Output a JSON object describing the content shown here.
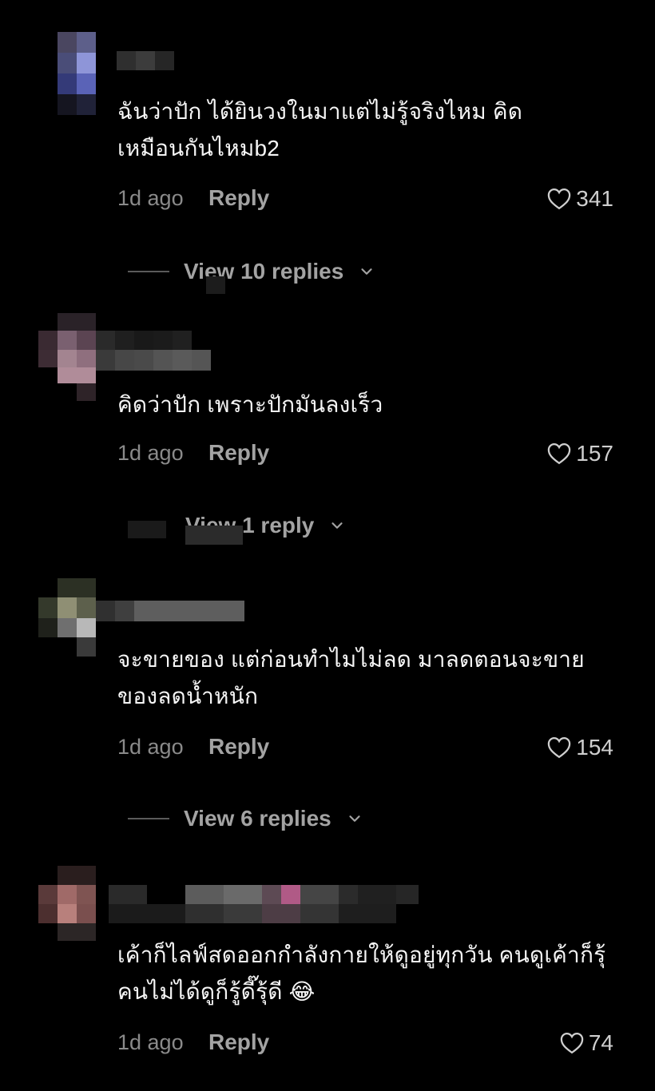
{
  "comments": [
    {
      "text": "ฉันว่าปัก ได้ยินวงในมาแต่ไม่รู้จริงไหม คิดเหมือนกันไหมb2",
      "time": "1d ago",
      "reply_label": "Reply",
      "likes": "341",
      "view_replies": "View 10 replies"
    },
    {
      "text": "คิดว่าปัก เพราะปักมันลงเร็ว",
      "time": "1d ago",
      "reply_label": "Reply",
      "likes": "157",
      "view_replies": "View 1 reply"
    },
    {
      "text": "จะขายของ แต่ก่อนทำไมไม่ลด มาลดตอนจะขายของลดน้ำหนัก",
      "time": "1d ago",
      "reply_label": "Reply",
      "likes": "154",
      "view_replies": "View 6 replies"
    },
    {
      "text": "เค้าก็ไลฟ์สดออกกำลังกายให้ดูอยู่ทุกวัน คนดูเค้าก็รุ้ คนไม่ได้ดูก็รู้ดี๊รุ้ดี 😂",
      "time": "1d ago",
      "reply_label": "Reply",
      "likes": "74"
    }
  ],
  "icons": {
    "heart": "heart-icon",
    "chevron": "chevron-down-icon"
  },
  "colors": {
    "background": "#000000",
    "text": "#f5f5f5",
    "muted": "#8a8a8a",
    "action": "#a3a3a3"
  }
}
